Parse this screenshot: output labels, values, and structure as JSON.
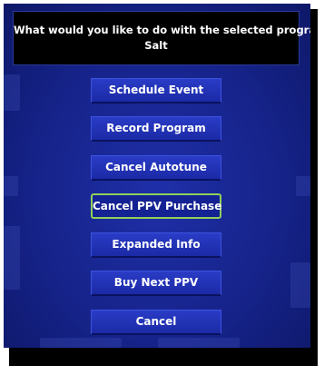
{
  "dialog": {
    "prompt_line1": "What would you like to do with the selected program",
    "prompt_line2": "Salt"
  },
  "menu": {
    "selected_index": 3,
    "items": [
      {
        "label": "Schedule Event"
      },
      {
        "label": "Record Program"
      },
      {
        "label": "Cancel Autotune"
      },
      {
        "label": "Cancel PPV Purchase"
      },
      {
        "label": "Expanded Info"
      },
      {
        "label": "Buy Next PPV"
      },
      {
        "label": "Cancel"
      }
    ]
  },
  "colors": {
    "background": "#16238a",
    "button": "#1f30b4",
    "highlight_border": "#8fd05a",
    "header_bg": "#000000"
  }
}
